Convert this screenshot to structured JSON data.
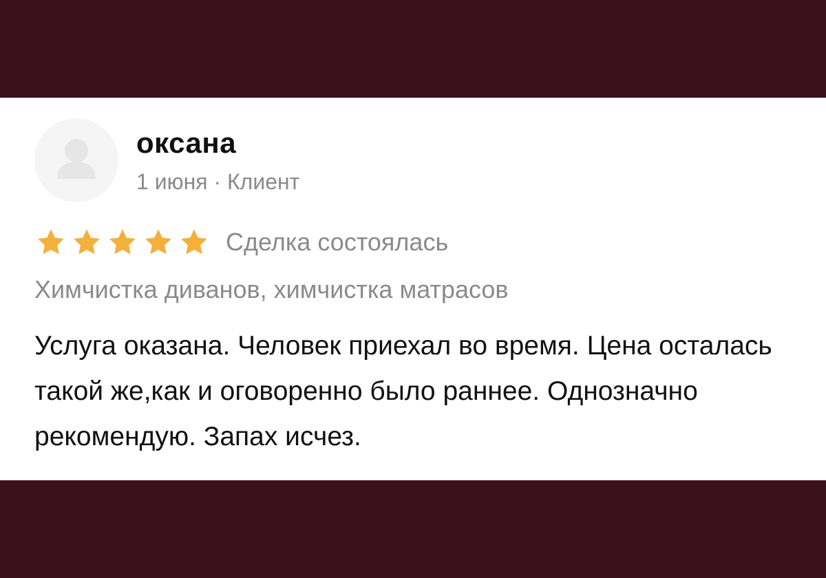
{
  "review": {
    "author": "оксана",
    "meta": "1 июня · Клиент",
    "rating": 5,
    "rating_max": 5,
    "deal_status": "Сделка состоялась",
    "services": "Химчистка диванов, химчистка матрасов",
    "text": "Услуга оказана. Человек приехал во время. Цена осталась такой же,как и оговоренно было раннее. Однозначно рекомендую. Запах исчез."
  },
  "colors": {
    "background": "#3a121c",
    "card": "#ffffff",
    "star": "#f3b03a",
    "muted_text": "#8a8a8a",
    "primary_text": "#111111",
    "avatar_bg": "#f5f5f5",
    "avatar_glyph": "#e6e6e6"
  },
  "icons": {
    "avatar": "user-silhouette-icon",
    "rating": "star-icon"
  }
}
